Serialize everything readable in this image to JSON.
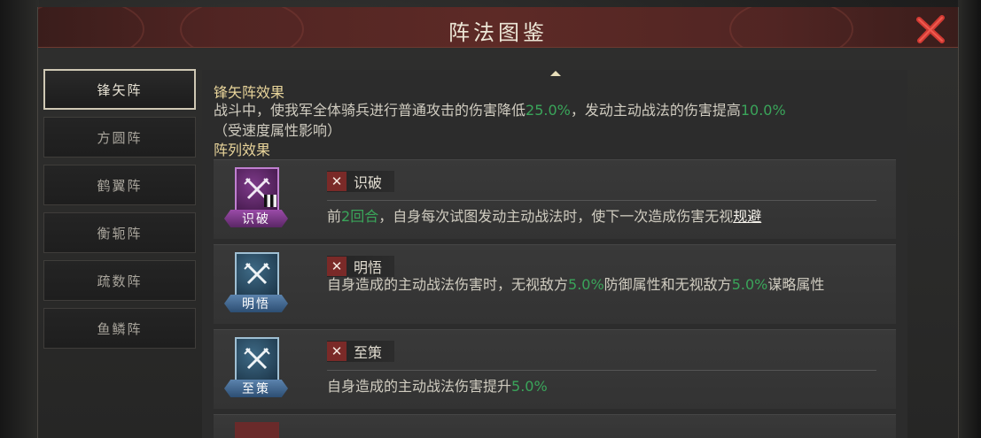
{
  "window": {
    "title": "阵法图鉴"
  },
  "sidebar": {
    "items": [
      {
        "label": "锋矢阵"
      },
      {
        "label": "方圆阵"
      },
      {
        "label": "鹤翼阵"
      },
      {
        "label": "衡轭阵"
      },
      {
        "label": "疏数阵"
      },
      {
        "label": "鱼鳞阵"
      }
    ],
    "selected": "锋矢阵"
  },
  "main": {
    "effect_title": "锋矢阵效果",
    "effect": {
      "part1": "战斗中，使我军全体骑兵进行普通攻击的伤害降低",
      "value1": "25.0%",
      "part2": "，发动主动战法的伤害提高",
      "value2": "10.0%",
      "part3": "（受速度属性影响）"
    },
    "list_title": "阵列效果",
    "cards": [
      {
        "icon": "crossed-swords-icon",
        "icon_label": "识破",
        "name": "识破",
        "text_a": "前",
        "highlight": "2回合",
        "text_b": "，自身每次试图发动主动战法时，使下一次造成伤害无视",
        "link": "规避"
      },
      {
        "icon": "crossed-swords-icon",
        "icon_label": "明悟",
        "name": "明悟",
        "text_a": "自身造成的主动战法伤害时，无视敌方",
        "value_a": "5.0%",
        "text_b": "防御属性和无视敌方",
        "value_b": "5.0%",
        "text_c": "谋略属性"
      },
      {
        "icon": "crossed-swords-icon",
        "icon_label": "至策",
        "name": "至策",
        "text_a": "自身造成的主动战法伤害提升",
        "value_a": "5.0%"
      }
    ]
  },
  "colors": {
    "accent_gold": "#e8d49a",
    "highlight_green": "#3aa55a",
    "title_red": "#5d2a26",
    "close_red": "#d23a33"
  }
}
